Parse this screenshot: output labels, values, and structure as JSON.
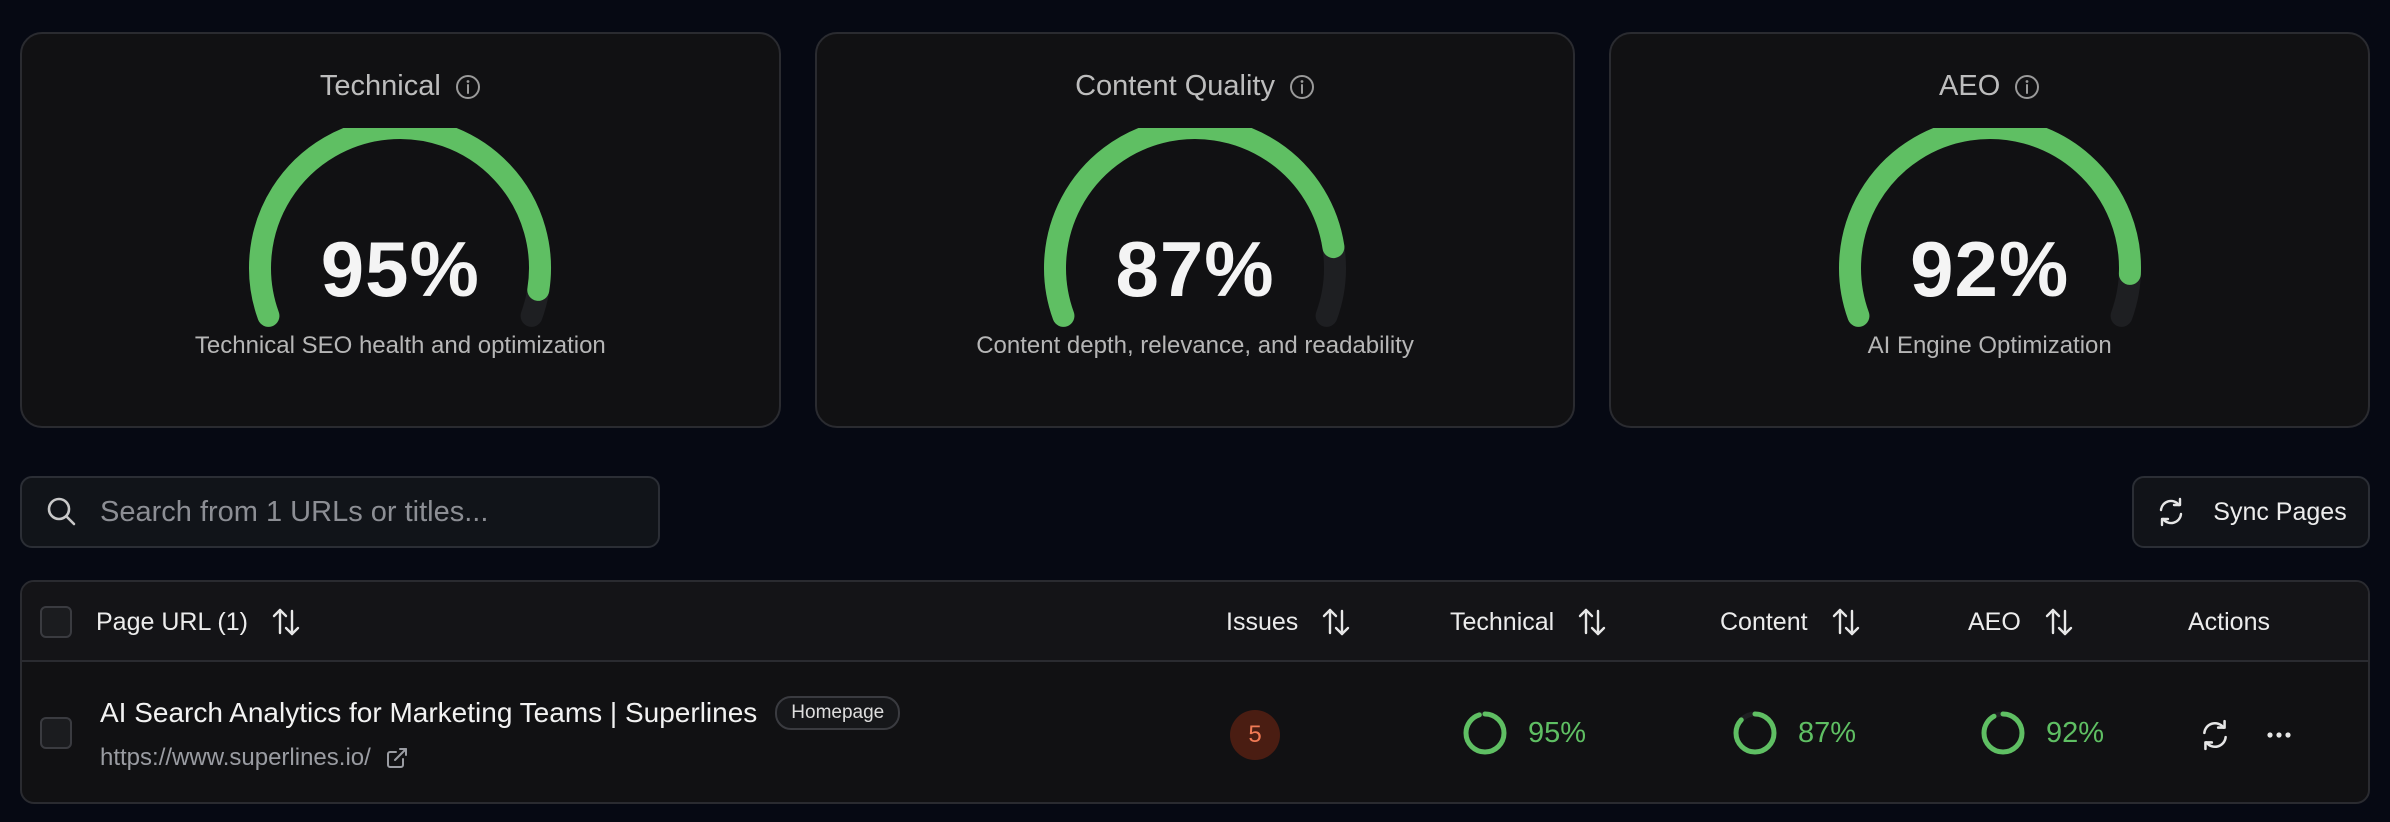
{
  "colors": {
    "gauge_green": "#5fbf63",
    "gauge_track": "#1e1f22",
    "issue_badge_bg": "#4a1d12",
    "issue_badge_text": "#f07a55"
  },
  "cards": [
    {
      "title": "Technical",
      "value": 95,
      "value_label": "95%",
      "description": "Technical SEO health and optimization",
      "icon": "info-icon"
    },
    {
      "title": "Content Quality",
      "value": 87,
      "value_label": "87%",
      "description": "Content depth, relevance, and readability",
      "icon": "info-icon"
    },
    {
      "title": "AEO",
      "value": 92,
      "value_label": "92%",
      "description": "AI Engine Optimization",
      "icon": "info-icon"
    }
  ],
  "search": {
    "placeholder": "Search from 1 URLs or titles...",
    "value": "",
    "icon": "search-icon"
  },
  "sync_button": {
    "label": "Sync Pages",
    "icon": "refresh-icon"
  },
  "table": {
    "headers": {
      "page_url": "Page URL (1)",
      "issues": "Issues",
      "technical": "Technical",
      "content": "Content",
      "aeo": "AEO",
      "actions": "Actions"
    },
    "rows": [
      {
        "title": "AI Search Analytics for Marketing Teams | Superlines",
        "badge": "Homepage",
        "url": "https://www.superlines.io/",
        "issues": "5",
        "technical": {
          "value": 95,
          "label": "95%"
        },
        "content": {
          "value": 87,
          "label": "87%"
        },
        "aeo": {
          "value": 92,
          "label": "92%"
        }
      }
    ]
  }
}
